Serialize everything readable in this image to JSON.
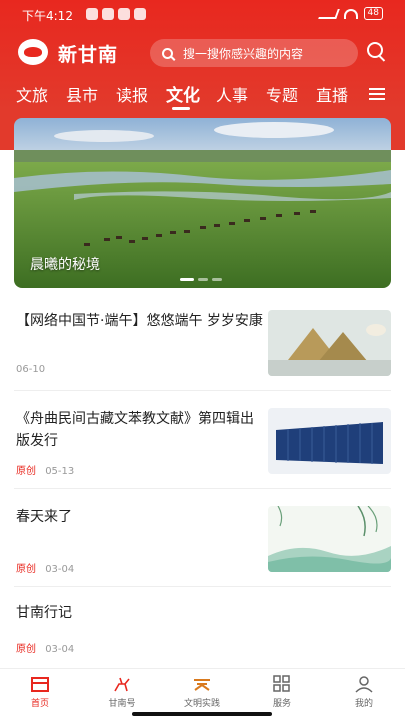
{
  "status_bar": {
    "time": "下午4:12",
    "battery": "48"
  },
  "header": {
    "logo_text": "新甘南",
    "search_placeholder": "搜一搜你感兴趣的内容",
    "tabs": [
      {
        "label": "文旅"
      },
      {
        "label": "县市"
      },
      {
        "label": "读报"
      },
      {
        "label": "文化",
        "active": true
      },
      {
        "label": "人事"
      },
      {
        "label": "专题"
      },
      {
        "label": "直播"
      }
    ]
  },
  "banner": {
    "caption": "晨曦的秘境",
    "slide_count": 3,
    "active_slide": 1
  },
  "news": [
    {
      "title": "【网络中国节·端午】悠悠端午 岁岁安康",
      "tag": "",
      "date": "06-10",
      "thumb": "zongzi-photo"
    },
    {
      "title": "《舟曲民间古藏文苯教文献》第四辑出版发行",
      "tag": "原创",
      "date": "05-13",
      "thumb": "bookshelf-photo"
    },
    {
      "title": "春天来了",
      "tag": "原创",
      "date": "03-04",
      "thumb": "spring-illustration"
    },
    {
      "title": "甘南行记",
      "tag": "原创",
      "date": "03-04",
      "thumb": ""
    }
  ],
  "bottom_nav": [
    {
      "label": "首页",
      "icon": "home-icon",
      "active": true
    },
    {
      "label": "甘南号",
      "icon": "deer-icon"
    },
    {
      "label": "文明实践",
      "icon": "civilization-icon"
    },
    {
      "label": "服务",
      "icon": "grid-icon"
    },
    {
      "label": "我的",
      "icon": "user-icon"
    }
  ],
  "colors": {
    "brand_red": "#e8281f",
    "text_dark": "#222222",
    "meta_gray": "#999999"
  }
}
